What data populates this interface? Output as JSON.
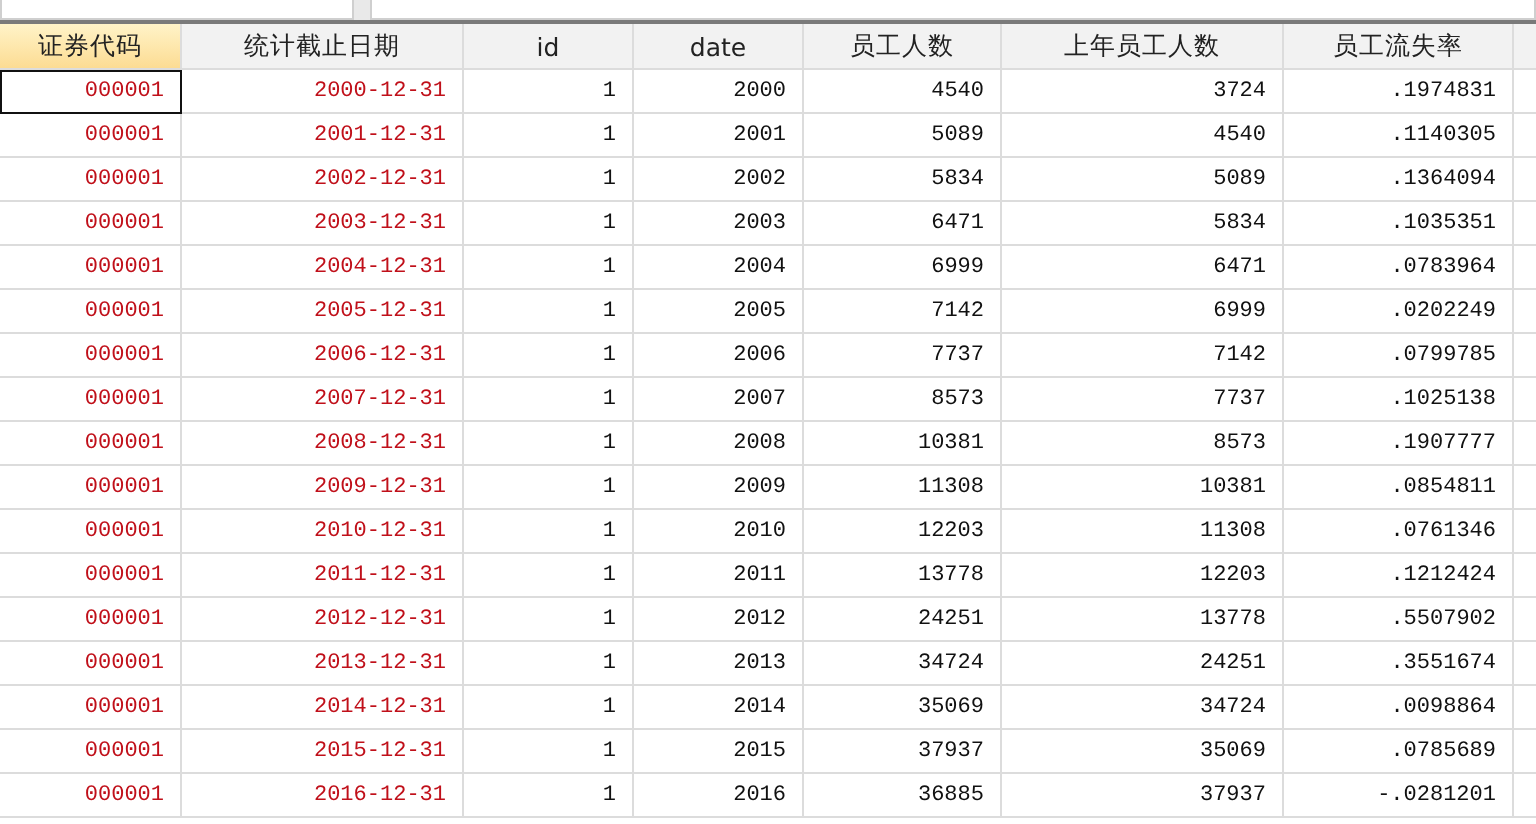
{
  "table": {
    "columns": [
      {
        "label": "证券代码",
        "kind": "string",
        "selected": true
      },
      {
        "label": "统计截止日期",
        "kind": "string",
        "selected": false
      },
      {
        "label": "id",
        "kind": "numeric",
        "selected": false
      },
      {
        "label": "date",
        "kind": "numeric",
        "selected": false
      },
      {
        "label": "员工人数",
        "kind": "numeric",
        "selected": false
      },
      {
        "label": "上年员工人数",
        "kind": "numeric",
        "selected": false
      },
      {
        "label": "员工流失率",
        "kind": "numeric",
        "selected": false
      }
    ],
    "rows": [
      {
        "selected": true,
        "cells": [
          "000001",
          "2000-12-31",
          "1",
          "2000",
          "4540",
          "3724",
          ".1974831"
        ]
      },
      {
        "selected": false,
        "cells": [
          "000001",
          "2001-12-31",
          "1",
          "2001",
          "5089",
          "4540",
          ".1140305"
        ]
      },
      {
        "selected": false,
        "cells": [
          "000001",
          "2002-12-31",
          "1",
          "2002",
          "5834",
          "5089",
          ".1364094"
        ]
      },
      {
        "selected": false,
        "cells": [
          "000001",
          "2003-12-31",
          "1",
          "2003",
          "6471",
          "5834",
          ".1035351"
        ]
      },
      {
        "selected": false,
        "cells": [
          "000001",
          "2004-12-31",
          "1",
          "2004",
          "6999",
          "6471",
          ".0783964"
        ]
      },
      {
        "selected": false,
        "cells": [
          "000001",
          "2005-12-31",
          "1",
          "2005",
          "7142",
          "6999",
          ".0202249"
        ]
      },
      {
        "selected": false,
        "cells": [
          "000001",
          "2006-12-31",
          "1",
          "2006",
          "7737",
          "7142",
          ".0799785"
        ]
      },
      {
        "selected": false,
        "cells": [
          "000001",
          "2007-12-31",
          "1",
          "2007",
          "8573",
          "7737",
          ".1025138"
        ]
      },
      {
        "selected": false,
        "cells": [
          "000001",
          "2008-12-31",
          "1",
          "2008",
          "10381",
          "8573",
          ".1907777"
        ]
      },
      {
        "selected": false,
        "cells": [
          "000001",
          "2009-12-31",
          "1",
          "2009",
          "11308",
          "10381",
          ".0854811"
        ]
      },
      {
        "selected": false,
        "cells": [
          "000001",
          "2010-12-31",
          "1",
          "2010",
          "12203",
          "11308",
          ".0761346"
        ]
      },
      {
        "selected": false,
        "cells": [
          "000001",
          "2011-12-31",
          "1",
          "2011",
          "13778",
          "12203",
          ".1212424"
        ]
      },
      {
        "selected": false,
        "cells": [
          "000001",
          "2012-12-31",
          "1",
          "2012",
          "24251",
          "13778",
          ".5507902"
        ]
      },
      {
        "selected": false,
        "cells": [
          "000001",
          "2013-12-31",
          "1",
          "2013",
          "34724",
          "24251",
          ".3551674"
        ]
      },
      {
        "selected": false,
        "cells": [
          "000001",
          "2014-12-31",
          "1",
          "2014",
          "35069",
          "34724",
          ".0098864"
        ]
      },
      {
        "selected": false,
        "cells": [
          "000001",
          "2015-12-31",
          "1",
          "2015",
          "37937",
          "35069",
          ".0785689"
        ]
      },
      {
        "selected": false,
        "cells": [
          "000001",
          "2016-12-31",
          "1",
          "2016",
          "36885",
          "37937",
          "-.0281201"
        ]
      }
    ]
  }
}
